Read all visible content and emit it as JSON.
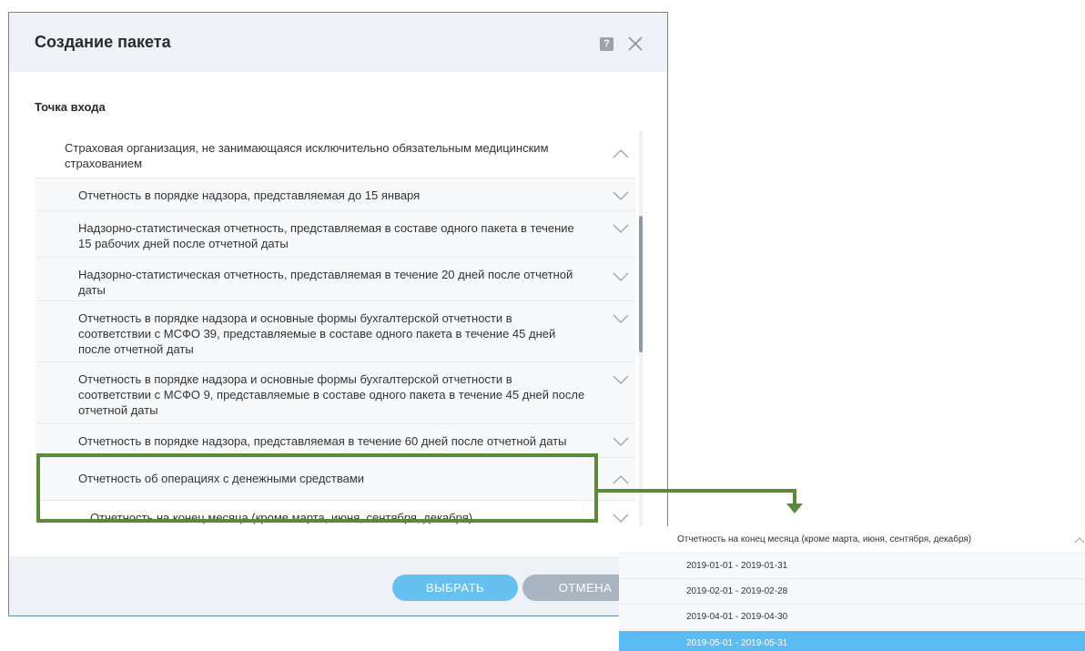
{
  "dialog": {
    "title": "Создание пакета",
    "help_label": "?",
    "section_label": "Точка входа"
  },
  "tree": {
    "items": [
      {
        "label": "Страховая организация, не занимающаяся исключительно обязательным медицинским страхованием",
        "level": 0,
        "expanded": true
      },
      {
        "label": "Отчетность в порядке надзора, представляемая до 15 января",
        "level": 1,
        "expanded": false
      },
      {
        "label": "Надзорно-статистическая отчетность, представляемая в составе одного пакета в течение 15 рабочих дней после отчетной даты",
        "level": 1,
        "expanded": false
      },
      {
        "label": "Надзорно-статистическая отчетность, представляемая в течение 20 дней после отчетной даты",
        "level": 1,
        "expanded": false
      },
      {
        "label": "Отчетность в порядке надзора и основные формы бухгалтерской отчетности в соответствии с МСФО 39, представляемые в составе одного пакета в течение 45 дней после отчетной даты",
        "level": 1,
        "expanded": false
      },
      {
        "label": "Отчетность в порядке надзора и основные формы бухгалтерской отчетности в соответствии с МСФО 9, представляемые в составе одного пакета в течение 45 дней после отчетной даты",
        "level": 1,
        "expanded": false
      },
      {
        "label": "Отчетность в порядке надзора, представляемая в течение 60 дней после отчетной даты",
        "level": 1,
        "expanded": false
      },
      {
        "label": "Отчетность об операциях с денежными средствами",
        "level": 1,
        "expanded": true
      },
      {
        "label": "Отчетность на конец месяца (кроме марта, июня, сентября, декабря)",
        "level": 2,
        "expanded": false
      }
    ]
  },
  "footer": {
    "select_label": "ВЫБРАТЬ",
    "cancel_label": "ОТМЕНА"
  },
  "zoom": {
    "header": "Отчетность на конец месяца (кроме марта, июня, сентября, декабря)",
    "periods": [
      {
        "label": "2019-01-01 - 2019-01-31",
        "selected": false
      },
      {
        "label": "2019-02-01 - 2019-02-28",
        "selected": false
      },
      {
        "label": "2019-04-01 - 2019-04-30",
        "selected": false
      },
      {
        "label": "2019-05-01 - 2019-05-31",
        "selected": true
      }
    ]
  },
  "colors": {
    "accent": "#66c0f0",
    "selected_row": "#5bbcf3",
    "highlight": "#5a8a35",
    "cancel": "#a9b6c2"
  }
}
